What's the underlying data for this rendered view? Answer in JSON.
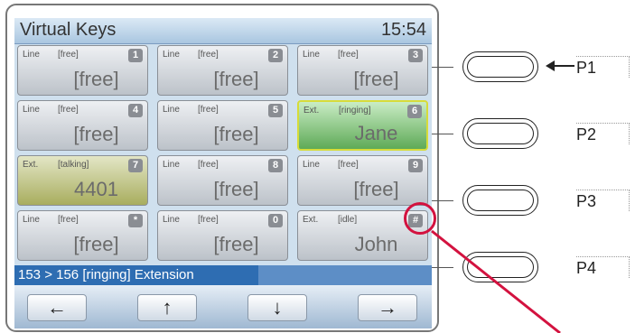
{
  "title": "Virtual Keys",
  "clock": "15:54",
  "keys": [
    {
      "type": "Line",
      "status": "[free]",
      "num": "1",
      "main": "[free]",
      "state": "free"
    },
    {
      "type": "Line",
      "status": "[free]",
      "num": "2",
      "main": "[free]",
      "state": "free"
    },
    {
      "type": "Line",
      "status": "[free]",
      "num": "3",
      "main": "[free]",
      "state": "free"
    },
    {
      "type": "Line",
      "status": "[free]",
      "num": "4",
      "main": "[free]",
      "state": "free"
    },
    {
      "type": "Line",
      "status": "[free]",
      "num": "5",
      "main": "[free]",
      "state": "free"
    },
    {
      "type": "Ext.",
      "status": "[ringing]",
      "num": "6",
      "main": "Jane",
      "state": "ringing"
    },
    {
      "type": "Ext.",
      "status": "[talking]",
      "num": "7",
      "main": "4401",
      "state": "talking"
    },
    {
      "type": "Line",
      "status": "[free]",
      "num": "8",
      "main": "[free]",
      "state": "free"
    },
    {
      "type": "Line",
      "status": "[free]",
      "num": "9",
      "main": "[free]",
      "state": "free"
    },
    {
      "type": "Line",
      "status": "[free]",
      "num": "*",
      "main": "[free]",
      "state": "free"
    },
    {
      "type": "Line",
      "status": "[free]",
      "num": "0",
      "main": "[free]",
      "state": "free"
    },
    {
      "type": "Ext.",
      "status": "[idle]",
      "num": "#",
      "main": "John",
      "state": "idle"
    }
  ],
  "status_line": "153 > 156 [ringing] Extension",
  "nav": {
    "left": "←",
    "up": "↑",
    "down": "↓",
    "right": "→"
  },
  "programmable": {
    "p1": "P1",
    "p2": "P2",
    "p3": "P3",
    "p4": "P4"
  },
  "colors": {
    "ringing": "#5faa57",
    "talking": "#a8ad5e",
    "highlight": "#d3123f",
    "statusbar": "#2e6db2"
  }
}
